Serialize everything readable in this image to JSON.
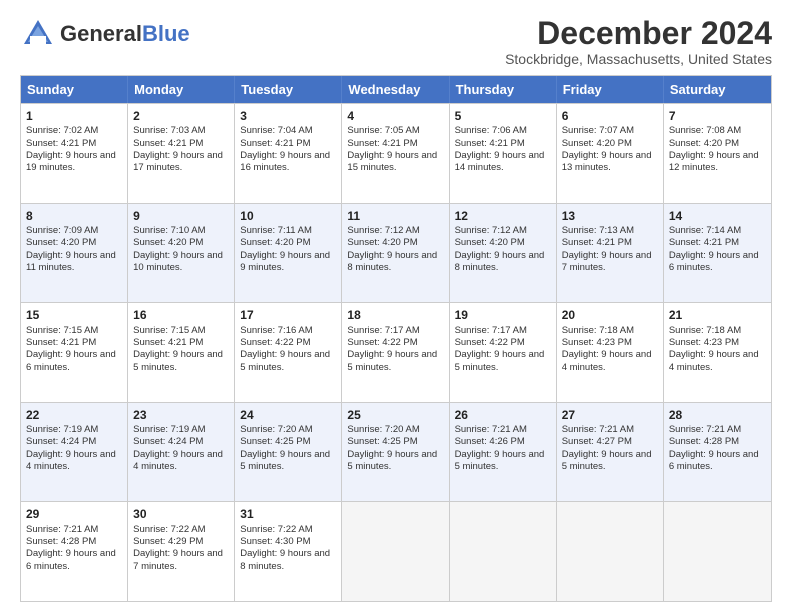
{
  "header": {
    "logo_general": "General",
    "logo_blue": "Blue",
    "month_title": "December 2024",
    "location": "Stockbridge, Massachusetts, United States"
  },
  "calendar": {
    "days": [
      "Sunday",
      "Monday",
      "Tuesday",
      "Wednesday",
      "Thursday",
      "Friday",
      "Saturday"
    ],
    "rows": [
      [
        {
          "num": "1",
          "sunrise": "7:02 AM",
          "sunset": "4:21 PM",
          "daylight": "9 hours and 19 minutes."
        },
        {
          "num": "2",
          "sunrise": "7:03 AM",
          "sunset": "4:21 PM",
          "daylight": "9 hours and 17 minutes."
        },
        {
          "num": "3",
          "sunrise": "7:04 AM",
          "sunset": "4:21 PM",
          "daylight": "9 hours and 16 minutes."
        },
        {
          "num": "4",
          "sunrise": "7:05 AM",
          "sunset": "4:21 PM",
          "daylight": "9 hours and 15 minutes."
        },
        {
          "num": "5",
          "sunrise": "7:06 AM",
          "sunset": "4:21 PM",
          "daylight": "9 hours and 14 minutes."
        },
        {
          "num": "6",
          "sunrise": "7:07 AM",
          "sunset": "4:20 PM",
          "daylight": "9 hours and 13 minutes."
        },
        {
          "num": "7",
          "sunrise": "7:08 AM",
          "sunset": "4:20 PM",
          "daylight": "9 hours and 12 minutes."
        }
      ],
      [
        {
          "num": "8",
          "sunrise": "7:09 AM",
          "sunset": "4:20 PM",
          "daylight": "9 hours and 11 minutes."
        },
        {
          "num": "9",
          "sunrise": "7:10 AM",
          "sunset": "4:20 PM",
          "daylight": "9 hours and 10 minutes."
        },
        {
          "num": "10",
          "sunrise": "7:11 AM",
          "sunset": "4:20 PM",
          "daylight": "9 hours and 9 minutes."
        },
        {
          "num": "11",
          "sunrise": "7:12 AM",
          "sunset": "4:20 PM",
          "daylight": "9 hours and 8 minutes."
        },
        {
          "num": "12",
          "sunrise": "7:12 AM",
          "sunset": "4:20 PM",
          "daylight": "9 hours and 8 minutes."
        },
        {
          "num": "13",
          "sunrise": "7:13 AM",
          "sunset": "4:21 PM",
          "daylight": "9 hours and 7 minutes."
        },
        {
          "num": "14",
          "sunrise": "7:14 AM",
          "sunset": "4:21 PM",
          "daylight": "9 hours and 6 minutes."
        }
      ],
      [
        {
          "num": "15",
          "sunrise": "7:15 AM",
          "sunset": "4:21 PM",
          "daylight": "9 hours and 6 minutes."
        },
        {
          "num": "16",
          "sunrise": "7:15 AM",
          "sunset": "4:21 PM",
          "daylight": "9 hours and 5 minutes."
        },
        {
          "num": "17",
          "sunrise": "7:16 AM",
          "sunset": "4:22 PM",
          "daylight": "9 hours and 5 minutes."
        },
        {
          "num": "18",
          "sunrise": "7:17 AM",
          "sunset": "4:22 PM",
          "daylight": "9 hours and 5 minutes."
        },
        {
          "num": "19",
          "sunrise": "7:17 AM",
          "sunset": "4:22 PM",
          "daylight": "9 hours and 5 minutes."
        },
        {
          "num": "20",
          "sunrise": "7:18 AM",
          "sunset": "4:23 PM",
          "daylight": "9 hours and 4 minutes."
        },
        {
          "num": "21",
          "sunrise": "7:18 AM",
          "sunset": "4:23 PM",
          "daylight": "9 hours and 4 minutes."
        }
      ],
      [
        {
          "num": "22",
          "sunrise": "7:19 AM",
          "sunset": "4:24 PM",
          "daylight": "9 hours and 4 minutes."
        },
        {
          "num": "23",
          "sunrise": "7:19 AM",
          "sunset": "4:24 PM",
          "daylight": "9 hours and 4 minutes."
        },
        {
          "num": "24",
          "sunrise": "7:20 AM",
          "sunset": "4:25 PM",
          "daylight": "9 hours and 5 minutes."
        },
        {
          "num": "25",
          "sunrise": "7:20 AM",
          "sunset": "4:25 PM",
          "daylight": "9 hours and 5 minutes."
        },
        {
          "num": "26",
          "sunrise": "7:21 AM",
          "sunset": "4:26 PM",
          "daylight": "9 hours and 5 minutes."
        },
        {
          "num": "27",
          "sunrise": "7:21 AM",
          "sunset": "4:27 PM",
          "daylight": "9 hours and 5 minutes."
        },
        {
          "num": "28",
          "sunrise": "7:21 AM",
          "sunset": "4:28 PM",
          "daylight": "9 hours and 6 minutes."
        }
      ],
      [
        {
          "num": "29",
          "sunrise": "7:21 AM",
          "sunset": "4:28 PM",
          "daylight": "9 hours and 6 minutes."
        },
        {
          "num": "30",
          "sunrise": "7:22 AM",
          "sunset": "4:29 PM",
          "daylight": "9 hours and 7 minutes."
        },
        {
          "num": "31",
          "sunrise": "7:22 AM",
          "sunset": "4:30 PM",
          "daylight": "9 hours and 8 minutes."
        },
        null,
        null,
        null,
        null
      ]
    ]
  }
}
